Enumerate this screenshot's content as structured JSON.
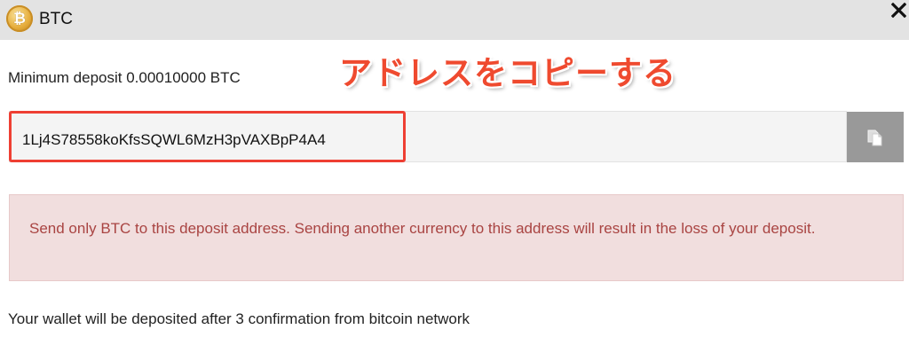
{
  "header": {
    "title": "BTC",
    "coin_icon": "bitcoin-coin-icon",
    "coin_symbol": "₿",
    "close_icon": "close-icon"
  },
  "deposit": {
    "minimum_label": "Minimum deposit 0.00010000 BTC",
    "address": "1Lj4S78558koKfsSQWL6MzH3pVAXBpP4A4",
    "copy_icon": "copy-icon"
  },
  "annotation": {
    "text": "アドレスをコピーする",
    "color": "#ef4a2f"
  },
  "alert": {
    "message": "Send only BTC to this deposit address. Sending another currency to this address will result in the loss of your deposit."
  },
  "footer": {
    "note": "Your wallet will be deposited after 3 confirmation from bitcoin network"
  },
  "colors": {
    "header_bg": "#e3e3e3",
    "alert_bg": "#f1dede",
    "alert_text": "#a94442",
    "highlight_border": "#ee3f33",
    "copy_button_bg": "#999999"
  }
}
